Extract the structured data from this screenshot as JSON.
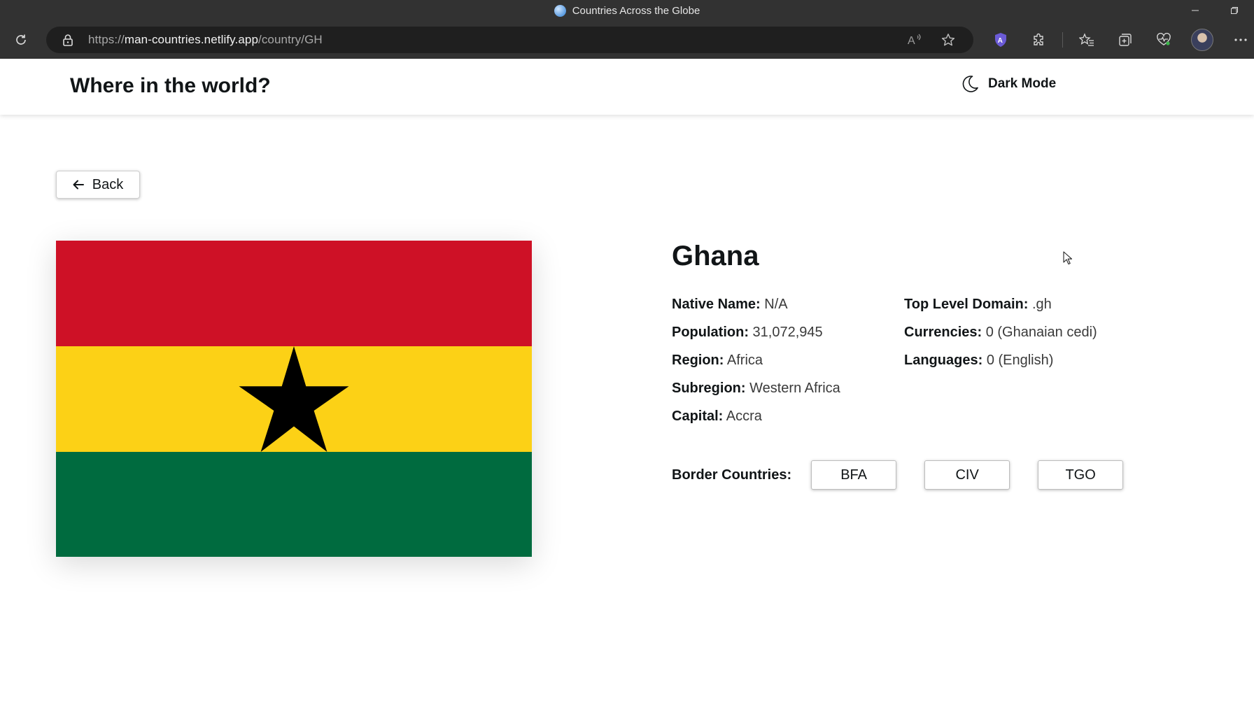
{
  "browser": {
    "tab_title": "Countries Across the Globe",
    "url_scheme": "https://",
    "url_host": "man-countries.netlify.app",
    "url_path": "/country/GH"
  },
  "header": {
    "title": "Where in the world?",
    "dark_mode_label": "Dark Mode"
  },
  "back_label": "Back",
  "country": {
    "name": "Ghana",
    "left": [
      {
        "key": "Native Name:",
        "value": "N/A"
      },
      {
        "key": "Population:",
        "value": "31,072,945"
      },
      {
        "key": "Region:",
        "value": "Africa"
      },
      {
        "key": "Subregion:",
        "value": "Western Africa"
      },
      {
        "key": "Capital:",
        "value": "Accra"
      }
    ],
    "right": [
      {
        "key": "Top Level Domain:",
        "value": ".gh"
      },
      {
        "key": "Currencies:",
        "value": "0 (Ghanaian cedi)"
      },
      {
        "key": "Languages:",
        "value": "0 (English)"
      }
    ],
    "borders_label": "Border Countries:",
    "borders": [
      "BFA",
      "CIV",
      "TGO"
    ],
    "flag_colors": {
      "red": "#ce1126",
      "yellow": "#fcd116",
      "green": "#006b3f",
      "star": "#000000"
    }
  },
  "icons": {
    "reload": "reload-icon",
    "lock": "lock-icon",
    "read_aloud": "read-aloud-icon",
    "favorite": "star-outline-icon",
    "moon": "moon-icon",
    "back_arrow": "arrow-left-icon"
  }
}
